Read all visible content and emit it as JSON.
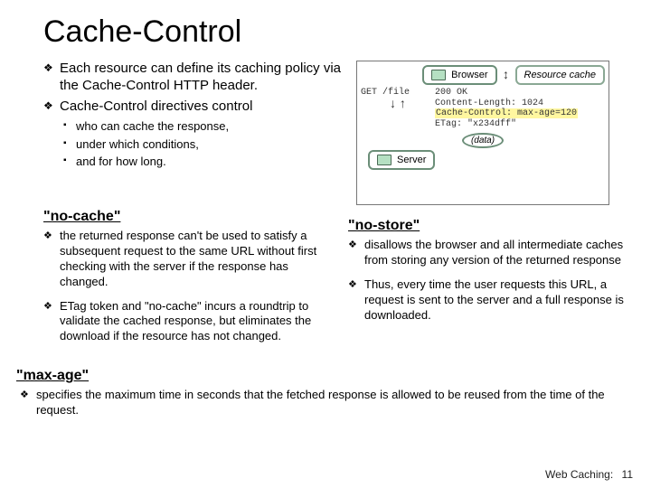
{
  "title": "Cache-Control",
  "top_bullets": {
    "b1": "Each resource can define its caching policy via the Cache-Control HTTP header.",
    "b2": "Cache-Control directives control"
  },
  "subs": {
    "s1": "who can cache the response,",
    "s2": "under which conditions,",
    "s3": "and for how long."
  },
  "diagram": {
    "browser": "Browser",
    "resource_cache": "Resource cache",
    "req": "GET /file",
    "resp1": "200 OK",
    "resp2": "Content-Length: 1024",
    "resp3_pre": "Cache-Control:",
    "resp3_hl": " max-age=120",
    "resp4": "ETag: \"x234dff\"",
    "data": "(data)",
    "server": "Server"
  },
  "no_cache": {
    "heading": "\"no-cache\"",
    "b1": "the returned response can't be used to satisfy a subsequent request to the same URL without first checking with the server if the response has changed.",
    "b2": "ETag token and \"no-cache\" incurs a roundtrip to validate the cached response, but eliminates the download if the resource has not changed."
  },
  "no_store": {
    "heading": "\"no-store\"",
    "b1": "disallows the browser and all intermediate caches from storing any version of the returned response",
    "b2": "Thus, every time the user requests this URL, a request is sent to the server and a full response is downloaded."
  },
  "max_age": {
    "heading": "\"max-age\"",
    "b1": "specifies the maximum time in seconds that the fetched response is allowed to be reused from the time of the request."
  },
  "footer": {
    "label": "Web Caching:",
    "page": "11"
  }
}
